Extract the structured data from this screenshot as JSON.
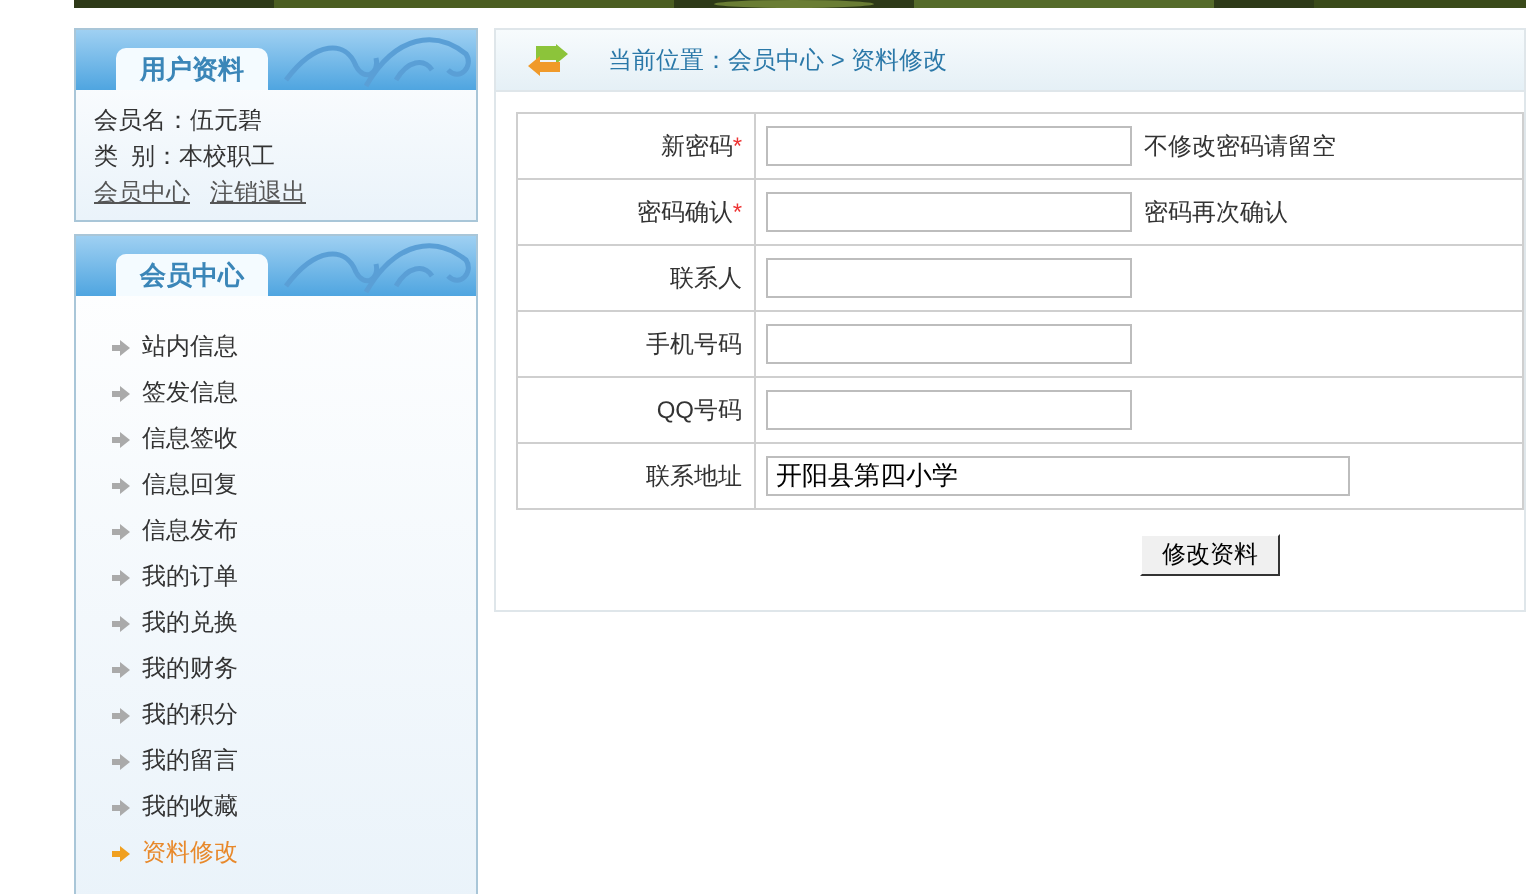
{
  "user_panel": {
    "title": "用户资料",
    "lines": [
      "会员名：伍元碧",
      "类  别：本校职工"
    ],
    "links": [
      "会员中心",
      "注销退出"
    ]
  },
  "member_panel": {
    "title": "会员中心",
    "items": [
      {
        "label": "站内信息",
        "selected": false
      },
      {
        "label": "签发信息",
        "selected": false
      },
      {
        "label": "信息签收",
        "selected": false
      },
      {
        "label": "信息回复",
        "selected": false
      },
      {
        "label": "信息发布",
        "selected": false
      },
      {
        "label": "我的订单",
        "selected": false
      },
      {
        "label": "我的兑换",
        "selected": false
      },
      {
        "label": "我的财务",
        "selected": false
      },
      {
        "label": "我的积分",
        "selected": false
      },
      {
        "label": "我的留言",
        "selected": false
      },
      {
        "label": "我的收藏",
        "selected": false
      },
      {
        "label": "资料修改",
        "selected": true
      }
    ]
  },
  "breadcrumb": "当前位置：会员中心 > 资料修改",
  "form": {
    "rows": [
      {
        "kind": "input",
        "label": "新密码",
        "mark": "*",
        "hint": "不修改密码请留空"
      },
      {
        "kind": "input",
        "label": "密码确认",
        "mark": "*",
        "hint": "密码再次确认"
      },
      {
        "kind": "input",
        "label": "联系人"
      },
      {
        "kind": "input",
        "label": "手机号码"
      },
      {
        "kind": "input",
        "label": "QQ号码"
      },
      {
        "kind": "wide_input",
        "label": "联系地址",
        "value": "开阳县第四小学"
      }
    ],
    "submit": "修改资料"
  }
}
